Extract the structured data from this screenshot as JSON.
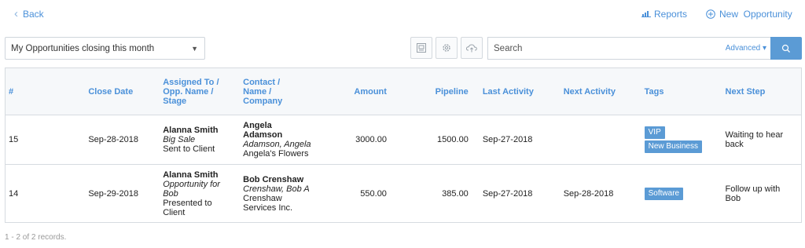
{
  "nav": {
    "back_label": "Back",
    "reports_label": "Reports",
    "new_opportunity_label": "New  Opportunity"
  },
  "toolbar": {
    "filter_value": "My Opportunities closing this month",
    "search_placeholder": "Search",
    "advanced_label": "Advanced ▾"
  },
  "table": {
    "headers": {
      "num": "#",
      "close_date": "Close Date",
      "assigned_1": "Assigned To /",
      "assigned_2": "Opp. Name /",
      "assigned_3": "Stage",
      "contact_1": "Contact /",
      "contact_2": "Name /",
      "contact_3": "Company",
      "amount": "Amount",
      "pipeline": "Pipeline",
      "last_activity": "Last Activity",
      "next_activity": "Next Activity",
      "tags": "Tags",
      "next_step": "Next Step"
    },
    "rows": [
      {
        "num": "15",
        "close_date": "Sep-28-2018",
        "assigned_to": "Alanna Smith",
        "opp_name": "Big Sale",
        "stage": "Sent to Client",
        "contact_1": "Angela",
        "contact_2": "Adamson",
        "name": "Adamson, Angela",
        "company": "Angela's Flowers",
        "amount": "3000.00",
        "pipeline": "1500.00",
        "last_activity": "Sep-27-2018",
        "next_activity": "",
        "tags": [
          "VIP",
          "New Business"
        ],
        "next_step_1": "Waiting to hear",
        "next_step_2": "back"
      },
      {
        "num": "14",
        "close_date": "Sep-29-2018",
        "assigned_to": "Alanna Smith",
        "opp_name_1": "Opportunity for",
        "opp_name_2": "Bob",
        "stage_1": "Presented to",
        "stage_2": "Client",
        "contact": "Bob Crenshaw",
        "name": "Crenshaw, Bob A",
        "company_1": "Crenshaw",
        "company_2": "Services Inc.",
        "amount": "550.00",
        "pipeline": "385.00",
        "last_activity": "Sep-27-2018",
        "next_activity": "Sep-28-2018",
        "tags": [
          "Software"
        ],
        "next_step_1": "Follow up with",
        "next_step_2": "Bob"
      }
    ]
  },
  "footer": {
    "records_text": "1 - 2 of 2 records."
  },
  "colors": {
    "accent": "#4a90d9",
    "tag_bg": "#5b9bd5",
    "search_button": "#5b9bd5"
  },
  "icons": [
    "chevron-left-icon",
    "bar-chart-icon",
    "plus-circle-icon",
    "print-icon",
    "gear-icon",
    "cloud-icon",
    "search-icon",
    "caret-down-icon"
  ]
}
